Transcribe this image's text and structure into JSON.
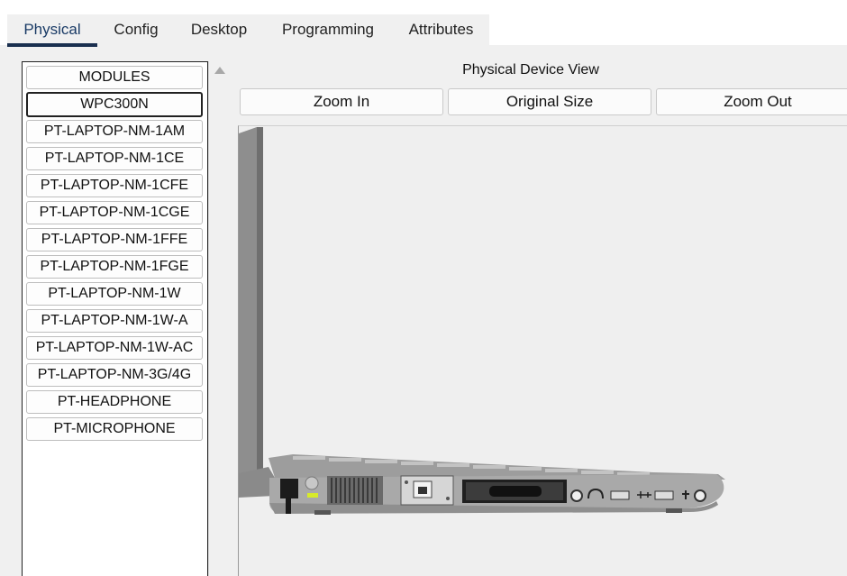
{
  "tabs": [
    {
      "label": "Physical",
      "active": true
    },
    {
      "label": "Config",
      "active": false
    },
    {
      "label": "Desktop",
      "active": false
    },
    {
      "label": "Programming",
      "active": false
    },
    {
      "label": "Attributes",
      "active": false
    }
  ],
  "modules": {
    "header": "MODULES",
    "selected": "WPC300N",
    "items": [
      "WPC300N",
      "PT-LAPTOP-NM-1AM",
      "PT-LAPTOP-NM-1CE",
      "PT-LAPTOP-NM-1CFE",
      "PT-LAPTOP-NM-1CGE",
      "PT-LAPTOP-NM-1FFE",
      "PT-LAPTOP-NM-1FGE",
      "PT-LAPTOP-NM-1W",
      "PT-LAPTOP-NM-1W-A",
      "PT-LAPTOP-NM-1W-AC",
      "PT-LAPTOP-NM-3G/4G",
      "PT-HEADPHONE",
      "PT-MICROPHONE"
    ]
  },
  "view": {
    "title": "Physical Device View",
    "zoom_in": "Zoom In",
    "original_size": "Original Size",
    "zoom_out": "Zoom Out"
  },
  "colors": {
    "active_tab_underline": "#1a2f4f",
    "laptop_body": "#a9a9a9",
    "power_led": "#d7ea2a"
  }
}
